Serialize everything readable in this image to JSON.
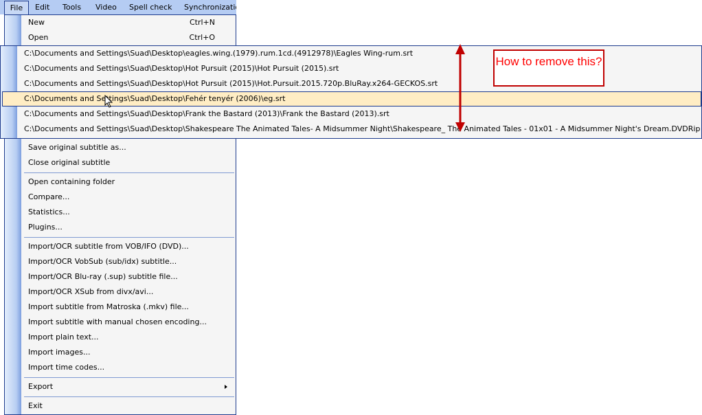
{
  "menubar": [
    "File",
    "Edit",
    "Tools",
    "Video",
    "Spell check",
    "Synchronizatio"
  ],
  "file_menu": {
    "new": {
      "label": "New",
      "shortcut": "Ctrl+N"
    },
    "open": {
      "label": "Open",
      "shortcut": "Ctrl+O"
    },
    "save_original": "Save original subtitle as...",
    "close_original": "Close original subtitle",
    "open_folder": "Open containing folder",
    "compare": "Compare...",
    "statistics": "Statistics...",
    "plugins": "Plugins...",
    "imports": [
      "Import/OCR subtitle from VOB/IFO (DVD)...",
      "Import/OCR VobSub (sub/idx) subtitle...",
      "Import/OCR Blu-ray (.sup) subtitle file...",
      "Import/OCR XSub from divx/avi...",
      "Import subtitle from Matroska (.mkv) file...",
      "Import subtitle with manual chosen encoding...",
      "Import plain text...",
      "Import images...",
      "Import time codes..."
    ],
    "export": "Export",
    "exit": "Exit"
  },
  "recent_files": [
    "C:\\Documents and Settings\\Suad\\Desktop\\eagles.wing.(1979).rum.1cd.(4912978)\\Eagles Wing-rum.srt",
    "C:\\Documents and Settings\\Suad\\Desktop\\Hot Pursuit (2015)\\Hot Pursuit (2015).srt",
    "C:\\Documents and Settings\\Suad\\Desktop\\Hot Pursuit (2015)\\Hot.Pursuit.2015.720p.BluRay.x264-GECKOS.srt",
    "C:\\Documents and Settings\\Suad\\Desktop\\Fehér tenyér (2006)\\eg.srt",
    "C:\\Documents and Settings\\Suad\\Desktop\\Frank the Bastard (2013)\\Frank the Bastard (2013).srt",
    "C:\\Documents and Settings\\Suad\\Desktop\\Shakespeare The Animated Tales- A Midsummer Night\\Shakespeare_ The Animated Tales - 01x01 - A Midsummer Night's Dream.DVDRip"
  ],
  "annotation": "How to remove this?",
  "colors": {
    "annotation": "#cc0000",
    "highlight": "#ffedc4",
    "border": "#1c3a8c"
  }
}
